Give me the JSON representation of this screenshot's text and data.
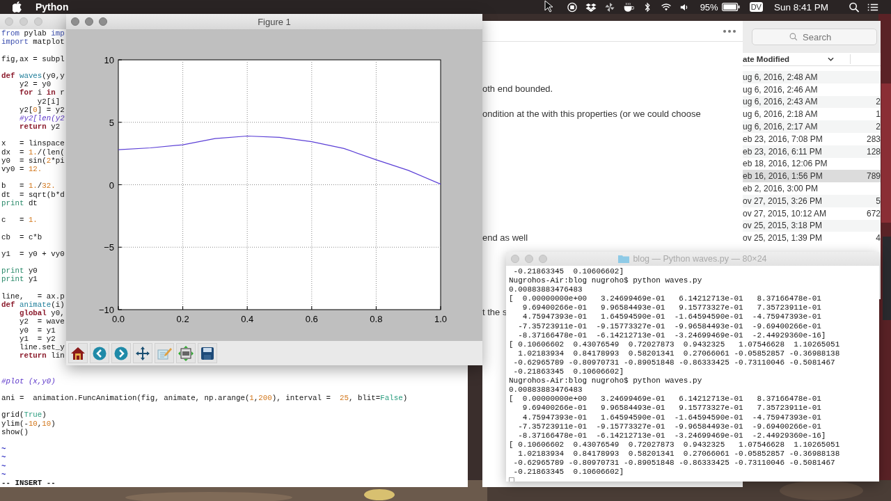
{
  "menubar": {
    "app_name": "Python",
    "battery": "95%",
    "user_badge": "DV",
    "clock": "Sun 8:41 PM"
  },
  "editor": {
    "lines": [
      {
        "kind": "code",
        "segments": [
          {
            "kind": "include",
            "text": "from"
          },
          {
            "kind": "plain",
            "text": " pylab "
          },
          {
            "kind": "include",
            "text": "imp"
          }
        ]
      },
      {
        "kind": "code",
        "segments": [
          {
            "kind": "include",
            "text": "import"
          },
          {
            "kind": "plain",
            "text": " matplot"
          }
        ]
      },
      {
        "kind": "blank"
      },
      {
        "kind": "code",
        "segments": [
          {
            "kind": "plain",
            "text": "fig,ax = subpl"
          }
        ]
      },
      {
        "kind": "blank"
      },
      {
        "kind": "code",
        "segments": [
          {
            "kind": "keyword",
            "text": "def"
          },
          {
            "kind": "function",
            "text": " waves"
          },
          {
            "kind": "plain",
            "text": "(y0,y"
          }
        ]
      },
      {
        "kind": "code",
        "segments": [
          {
            "kind": "plain",
            "text": "    y2 = y0"
          }
        ]
      },
      {
        "kind": "code",
        "segments": [
          {
            "kind": "keyword",
            "text": "    for"
          },
          {
            "kind": "plain",
            "text": " i "
          },
          {
            "kind": "keyword",
            "text": "in"
          },
          {
            "kind": "plain",
            "text": " r"
          }
        ]
      },
      {
        "kind": "code",
        "segments": [
          {
            "kind": "plain",
            "text": "        y2[i]"
          }
        ]
      },
      {
        "kind": "code",
        "segments": [
          {
            "kind": "plain",
            "text": "    y2["
          },
          {
            "kind": "number",
            "text": "0"
          },
          {
            "kind": "plain",
            "text": "] = y2"
          }
        ]
      },
      {
        "kind": "code",
        "segments": [
          {
            "kind": "comment",
            "text": "    #y2[len(y2"
          }
        ]
      },
      {
        "kind": "code",
        "segments": [
          {
            "kind": "keyword",
            "text": "    return"
          },
          {
            "kind": "plain",
            "text": " y2"
          }
        ]
      },
      {
        "kind": "blank"
      },
      {
        "kind": "code",
        "segments": [
          {
            "kind": "plain",
            "text": "x   = linspace"
          }
        ]
      },
      {
        "kind": "code",
        "segments": [
          {
            "kind": "plain",
            "text": "dx  = "
          },
          {
            "kind": "number",
            "text": "1."
          },
          {
            "kind": "plain",
            "text": "/(len("
          }
        ]
      },
      {
        "kind": "code",
        "segments": [
          {
            "kind": "plain",
            "text": "y0  = sin("
          },
          {
            "kind": "number",
            "text": "2"
          },
          {
            "kind": "plain",
            "text": "*pi"
          }
        ]
      },
      {
        "kind": "code",
        "segments": [
          {
            "kind": "plain",
            "text": "vy0 = "
          },
          {
            "kind": "number",
            "text": "12."
          }
        ]
      },
      {
        "kind": "blank"
      },
      {
        "kind": "code",
        "segments": [
          {
            "kind": "plain",
            "text": "b   = "
          },
          {
            "kind": "number",
            "text": "1."
          },
          {
            "kind": "plain",
            "text": "/"
          },
          {
            "kind": "number",
            "text": "32."
          }
        ]
      },
      {
        "kind": "code",
        "segments": [
          {
            "kind": "plain",
            "text": "dt  = sqrt(b*d"
          }
        ]
      },
      {
        "kind": "code",
        "segments": [
          {
            "kind": "statement",
            "text": "print"
          },
          {
            "kind": "plain",
            "text": " dt"
          }
        ]
      },
      {
        "kind": "blank"
      },
      {
        "kind": "code",
        "segments": [
          {
            "kind": "plain",
            "text": "c   = "
          },
          {
            "kind": "number",
            "text": "1."
          }
        ]
      },
      {
        "kind": "blank"
      },
      {
        "kind": "code",
        "segments": [
          {
            "kind": "plain",
            "text": "cb  = c*b"
          }
        ]
      },
      {
        "kind": "blank"
      },
      {
        "kind": "code",
        "segments": [
          {
            "kind": "plain",
            "text": "y1  = y0 + vy0"
          }
        ]
      },
      {
        "kind": "blank"
      },
      {
        "kind": "code",
        "segments": [
          {
            "kind": "statement",
            "text": "print"
          },
          {
            "kind": "plain",
            "text": " y0"
          }
        ]
      },
      {
        "kind": "code",
        "segments": [
          {
            "kind": "statement",
            "text": "print"
          },
          {
            "kind": "plain",
            "text": " y1"
          }
        ]
      },
      {
        "kind": "blank"
      },
      {
        "kind": "code",
        "segments": [
          {
            "kind": "plain",
            "text": "line,   = ax.p"
          }
        ]
      },
      {
        "kind": "code",
        "segments": [
          {
            "kind": "keyword",
            "text": "def"
          },
          {
            "kind": "function",
            "text": " animate"
          },
          {
            "kind": "plain",
            "text": "(i)"
          }
        ]
      },
      {
        "kind": "code",
        "segments": [
          {
            "kind": "keyword",
            "text": "    global"
          },
          {
            "kind": "plain",
            "text": " y0,"
          }
        ]
      },
      {
        "kind": "code",
        "segments": [
          {
            "kind": "plain",
            "text": "    y2  = wave"
          }
        ]
      },
      {
        "kind": "code",
        "segments": [
          {
            "kind": "plain",
            "text": "    y0  = y1"
          }
        ]
      },
      {
        "kind": "code",
        "segments": [
          {
            "kind": "plain",
            "text": "    y1  = y2"
          }
        ]
      },
      {
        "kind": "code",
        "segments": [
          {
            "kind": "plain",
            "text": "    line.set_y"
          }
        ]
      },
      {
        "kind": "code",
        "segments": [
          {
            "kind": "keyword",
            "text": "    return"
          },
          {
            "kind": "plain",
            "text": " lin"
          }
        ]
      },
      {
        "kind": "blank"
      },
      {
        "kind": "blank"
      },
      {
        "kind": "code",
        "segments": [
          {
            "kind": "comment",
            "text": "#plot (x,y0)"
          }
        ]
      },
      {
        "kind": "blank"
      },
      {
        "kind": "code",
        "segments": [
          {
            "kind": "plain",
            "text": "ani =  animation.FuncAnimation(fig, animate, np.arange("
          },
          {
            "kind": "number",
            "text": "1"
          },
          {
            "kind": "plain",
            "text": ","
          },
          {
            "kind": "number",
            "text": "200"
          },
          {
            "kind": "plain",
            "text": "), interval =  "
          },
          {
            "kind": "number",
            "text": "25"
          },
          {
            "kind": "plain",
            "text": ", blit="
          },
          {
            "kind": "constant",
            "text": "False"
          },
          {
            "kind": "plain",
            "text": ")"
          }
        ]
      },
      {
        "kind": "blank"
      },
      {
        "kind": "code",
        "segments": [
          {
            "kind": "plain",
            "text": "grid("
          },
          {
            "kind": "constant",
            "text": "True"
          },
          {
            "kind": "plain",
            "text": ")"
          }
        ]
      },
      {
        "kind": "code",
        "segments": [
          {
            "kind": "plain",
            "text": "ylim(-"
          },
          {
            "kind": "number",
            "text": "10"
          },
          {
            "kind": "plain",
            "text": ","
          },
          {
            "kind": "number",
            "text": "10"
          },
          {
            "kind": "plain",
            "text": ")"
          }
        ]
      },
      {
        "kind": "code",
        "segments": [
          {
            "kind": "plain",
            "text": "show()"
          }
        ]
      },
      {
        "kind": "blank"
      },
      {
        "kind": "tilde",
        "text": "~"
      },
      {
        "kind": "tilde",
        "text": "~"
      },
      {
        "kind": "tilde",
        "text": "~"
      },
      {
        "kind": "tilde",
        "text": "~"
      },
      {
        "kind": "status",
        "text": "-- INSERT --"
      }
    ]
  },
  "figure": {
    "title": "Figure 1",
    "chart_data": {
      "type": "line",
      "x": [
        0,
        0.1,
        0.2,
        0.3,
        0.4,
        0.5,
        0.6,
        0.7,
        0.8,
        0.9,
        1.0
      ],
      "series": [
        {
          "color": "#5b3fd6",
          "values": [
            2.8,
            2.95,
            3.2,
            3.7,
            3.9,
            3.8,
            3.45,
            2.9,
            2.0,
            1.15,
            0.05
          ]
        }
      ],
      "xlim": [
        0,
        1
      ],
      "ylim": [
        -10,
        10
      ],
      "grid": true,
      "xticks": [
        {
          "value": 0,
          "label": "0.0"
        },
        {
          "value": 0.2,
          "label": "0.2"
        },
        {
          "value": 0.4,
          "label": "0.4"
        },
        {
          "value": 0.6,
          "label": "0.6"
        },
        {
          "value": 0.8,
          "label": "0.8"
        },
        {
          "value": 1,
          "label": "1.0"
        }
      ],
      "yticks": [
        {
          "value": 10,
          "label": "10"
        },
        {
          "value": 5,
          "label": "5"
        },
        {
          "value": 0,
          "label": "0"
        },
        {
          "value": -5,
          "label": "−5"
        },
        {
          "value": -10,
          "label": "−10"
        }
      ]
    },
    "tools": [
      {
        "kind": "home"
      },
      {
        "kind": "back"
      },
      {
        "kind": "forward"
      },
      {
        "kind": "pan"
      },
      {
        "kind": "edit"
      },
      {
        "kind": "configure"
      },
      {
        "kind": "save"
      }
    ]
  },
  "document": {
    "paragraphs": [
      "oth end bounded.",
      "ondition at the with this properties (or we could choose",
      "end as well",
      "t the s"
    ]
  },
  "finder": {
    "search": {
      "placeholder": "Search"
    },
    "column": "ate Modified",
    "rows": [
      {
        "date": "ug 6, 2016, 2:48 AM",
        "selected": false
      },
      {
        "date": "ug 6, 2016, 2:46 AM",
        "selected": false
      },
      {
        "date": "ug 6, 2016, 2:43 AM",
        "size": "2",
        "selected": false
      },
      {
        "date": "ug 6, 2016, 2:18 AM",
        "size": "1",
        "selected": false
      },
      {
        "date": "ug 6, 2016, 2:17 AM",
        "size": "2",
        "selected": false
      },
      {
        "date": "eb 23, 2016, 7:08 PM",
        "size": "283",
        "selected": false
      },
      {
        "date": "eb 23, 2016, 6:11 PM",
        "size": "128",
        "selected": false
      },
      {
        "date": "eb 18, 2016, 12:06 PM",
        "selected": false
      },
      {
        "date": "eb 16, 2016, 1:56 PM",
        "size": "789",
        "selected": true
      },
      {
        "date": "eb 2, 2016, 3:00 PM",
        "selected": false
      },
      {
        "date": "ov 27, 2015, 3:26 PM",
        "size": "5",
        "selected": false
      },
      {
        "date": "ov 27, 2015, 10:12 AM",
        "size": "672",
        "selected": false
      },
      {
        "date": "ov 25, 2015, 3:18 PM",
        "selected": false
      },
      {
        "date": "ov 25, 2015, 1:39 PM",
        "size": "4",
        "selected": false
      }
    ]
  },
  "terminal": {
    "title": "blog — Python waves.py — 80×24",
    "lines": [
      " -0.21863345  0.10606602]",
      "Nugrohos-Air:blog nugroho$ python waves.py",
      "0.00883883476483",
      "[  0.00000000e+00   3.24699469e-01   6.14212713e-01   8.37166478e-01",
      "   9.69400266e-01   9.96584493e-01   9.15773327e-01   7.35723911e-01",
      "   4.75947393e-01   1.64594590e-01  -1.64594590e-01  -4.75947393e-01",
      "  -7.35723911e-01  -9.15773327e-01  -9.96584493e-01  -9.69400266e-01",
      "  -8.37166478e-01  -6.14212713e-01  -3.24699469e-01  -2.44929360e-16]",
      "[ 0.10606602  0.43076549  0.72027873  0.9432325   1.07546628  1.10265051",
      "  1.02183934  0.84178993  0.58201341  0.27066061 -0.05852857 -0.36988138",
      " -0.62965789 -0.80970731 -0.89051848 -0.86333425 -0.73110046 -0.5081467",
      " -0.21863345  0.10606602]",
      "Nugrohos-Air:blog nugroho$ python waves.py",
      "0.00883883476483",
      "[  0.00000000e+00   3.24699469e-01   6.14212713e-01   8.37166478e-01",
      "   9.69400266e-01   9.96584493e-01   9.15773327e-01   7.35723911e-01",
      "   4.75947393e-01   1.64594590e-01  -1.64594590e-01  -4.75947393e-01",
      "  -7.35723911e-01  -9.15773327e-01  -9.96584493e-01  -9.69400266e-01",
      "  -8.37166478e-01  -6.14212713e-01  -3.24699469e-01  -2.44929360e-16]",
      "[ 0.10606602  0.43076549  0.72027873  0.9432325   1.07546628  1.10265051",
      "  1.02183934  0.84178993  0.58201341  0.27066061 -0.05852857 -0.36988138",
      " -0.62965789 -0.80970731 -0.89051848 -0.86333425 -0.73110046 -0.5081467",
      " -0.21863345  0.10606602]"
    ]
  }
}
